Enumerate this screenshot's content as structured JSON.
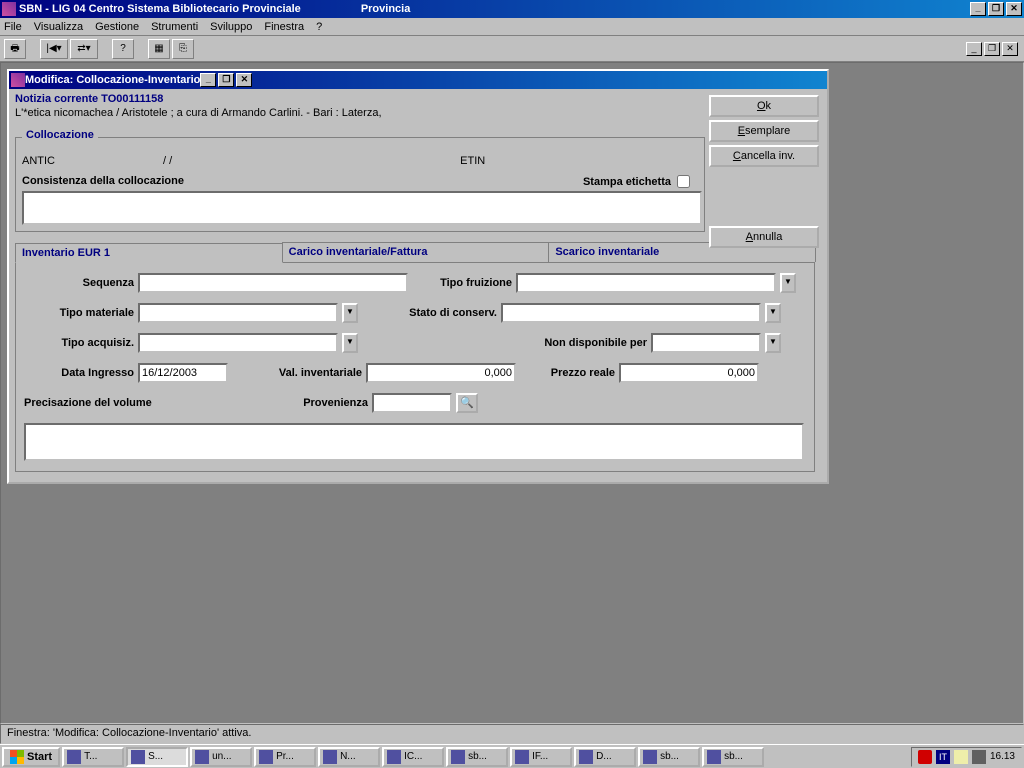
{
  "app": {
    "title_left": "SBN - LIG 04 Centro Sistema Bibliotecario Provinciale",
    "title_right": "Provincia"
  },
  "menu": [
    "File",
    "Visualizza",
    "Gestione",
    "Strumenti",
    "Sviluppo",
    "Finestra",
    "?"
  ],
  "child": {
    "title": "Modifica: Collocazione-Inventario",
    "notizia_label": "Notizia corrente  TO00111158",
    "notizia_desc": "L'*etica nicomachea / Aristotele ; a cura di Armando Carlini. - Bari : Laterza,",
    "buttons": {
      "ok": "Ok",
      "esemplare": "Esemplare",
      "cancella": "Cancella inv.",
      "annulla": "Annulla"
    },
    "colloc": {
      "legend": "Collocazione",
      "left": "ANTIC",
      "sep": "/  /",
      "right": "ETIN",
      "consistenza_label": "Consistenza della collocazione",
      "stampa_label": "Stampa etichetta"
    },
    "tabs": {
      "t1": "Inventario EUR   1",
      "t2": "Carico inventariale/Fattura",
      "t3": "Scarico inventariale"
    },
    "form": {
      "sequenza": "Sequenza",
      "tipo_fruizione": "Tipo fruizione",
      "tipo_materiale": "Tipo materiale",
      "stato_conserv": "Stato di conserv.",
      "tipo_acquisiz": "Tipo acquisiz.",
      "non_disp": "Non disponibile per",
      "data_ingresso": "Data Ingresso",
      "data_ingresso_val": "16/12/2003",
      "val_inv": "Val. inventariale",
      "val_inv_val": "0,000",
      "prezzo": "Prezzo reale",
      "prezzo_val": "0,000",
      "precisazione": "Precisazione del volume",
      "provenienza": "Provenienza"
    }
  },
  "status": "Finestra: 'Modifica: Collocazione-Inventario' attiva.",
  "taskbar": {
    "start": "Start",
    "tasks": [
      "T...",
      "S...",
      "un...",
      "Pr...",
      "N...",
      "IC...",
      "sb...",
      "IF...",
      "D...",
      "sb...",
      "sb..."
    ],
    "active_index": 1,
    "clock": "16.13",
    "lang": "IT"
  }
}
